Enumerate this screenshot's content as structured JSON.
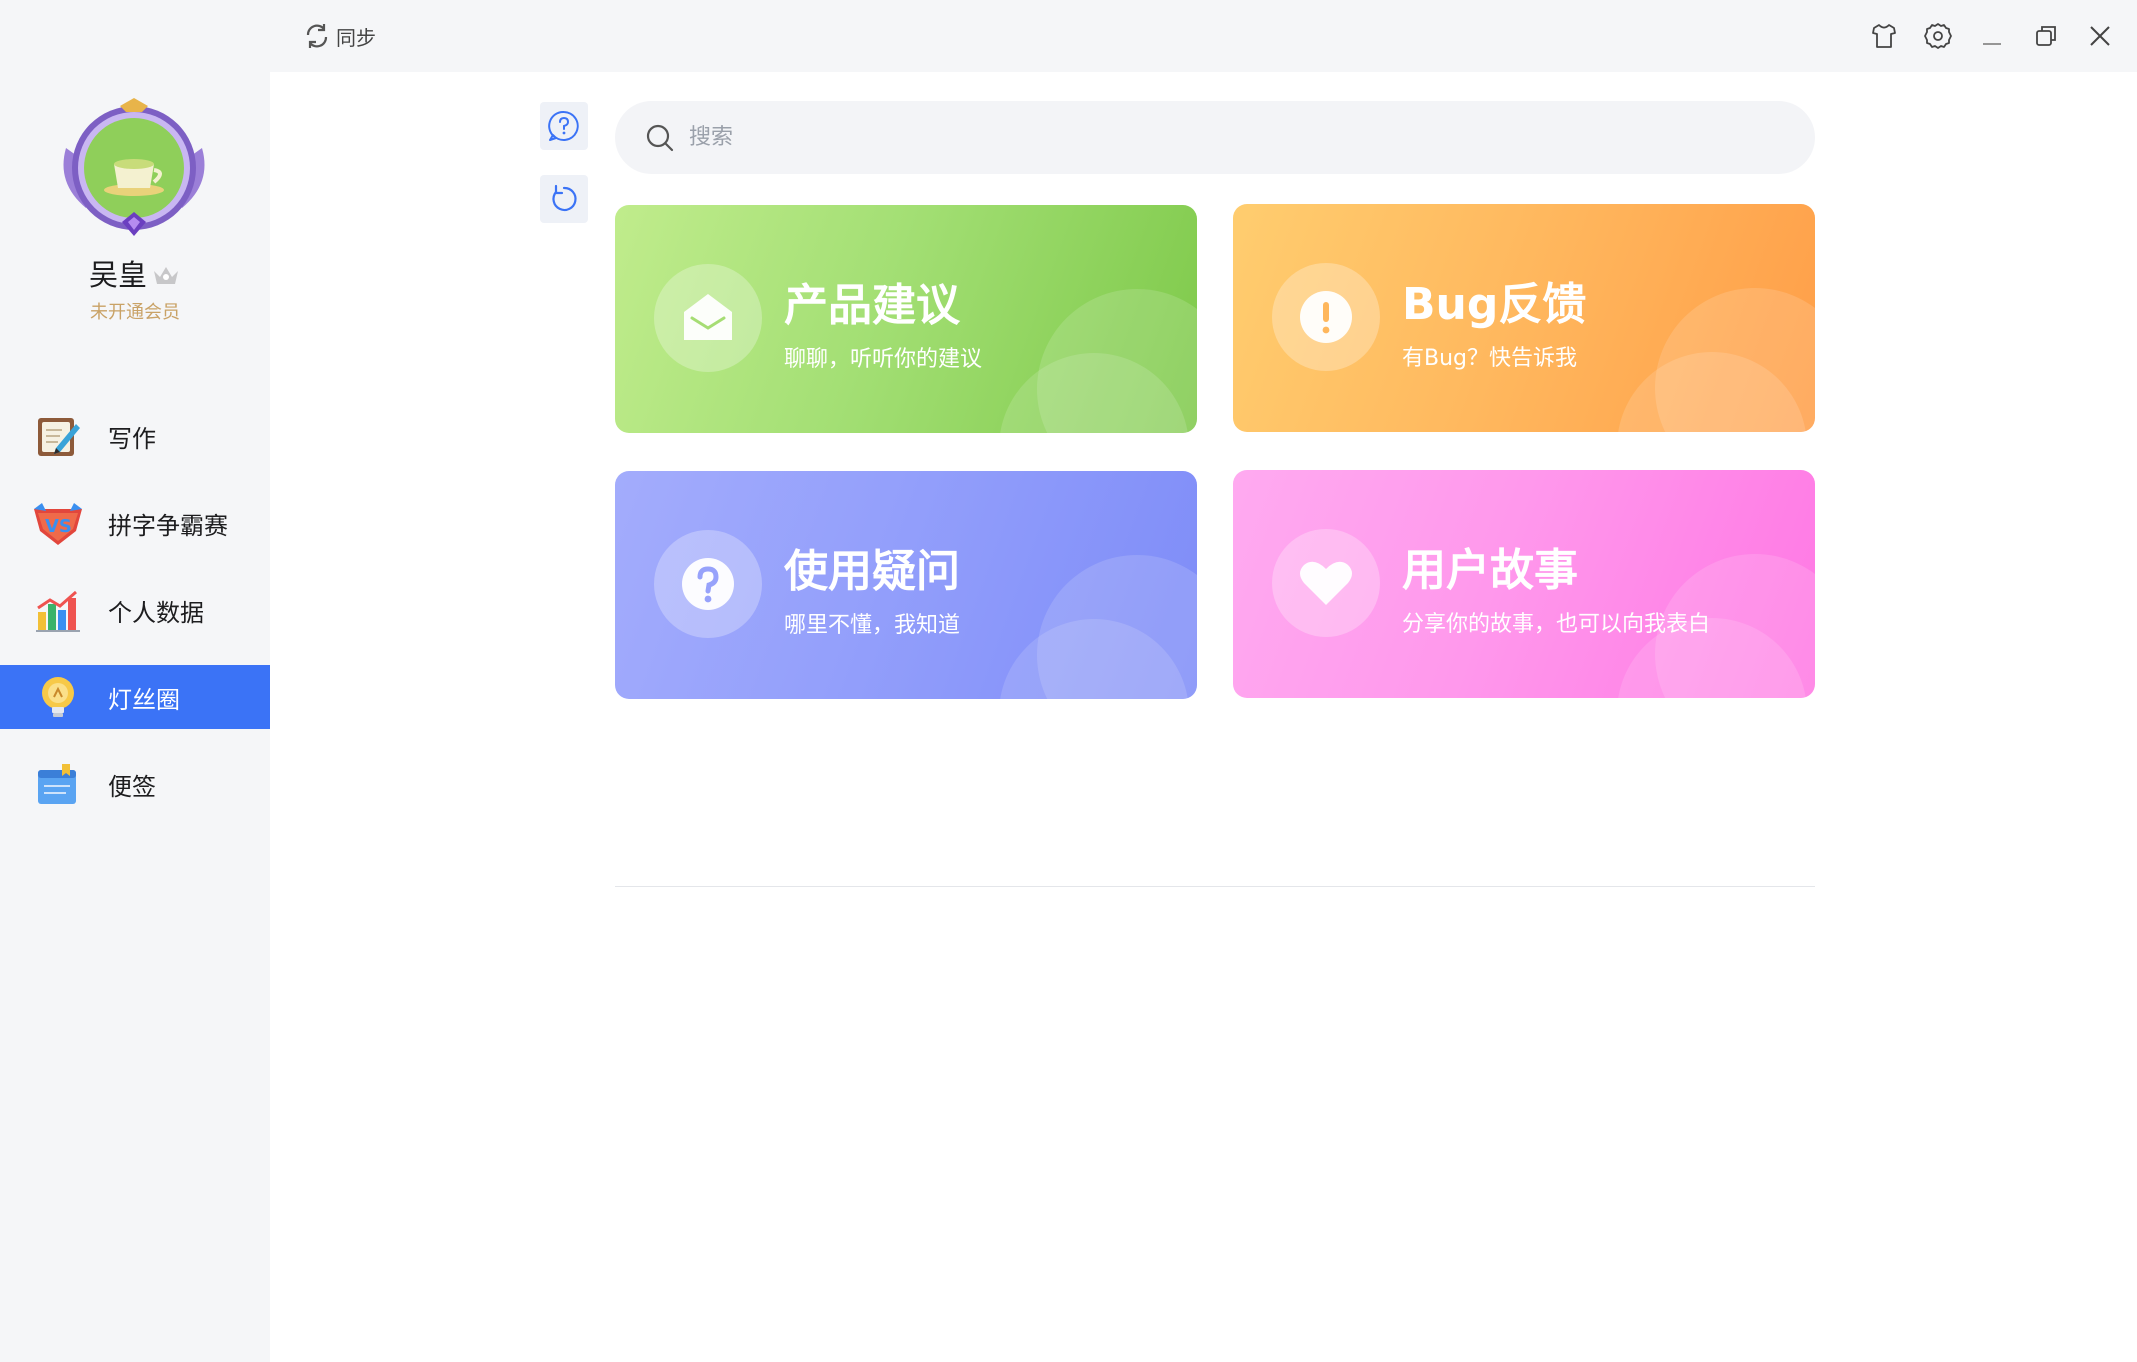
{
  "titlebar": {
    "sync_label": "同步",
    "icons": [
      "shirt-icon",
      "gear-icon",
      "minimize-icon",
      "restore-icon",
      "close-icon"
    ]
  },
  "profile": {
    "username": "吴皇",
    "member_status": "未开通会员"
  },
  "nav": {
    "items": [
      {
        "label": "写作",
        "icon": "writing-icon"
      },
      {
        "label": "拼字争霸赛",
        "icon": "vs-icon"
      },
      {
        "label": "个人数据",
        "icon": "bar-chart-icon"
      },
      {
        "label": "灯丝圈",
        "icon": "bulb-icon",
        "active": true
      },
      {
        "label": "便签",
        "icon": "notepad-icon"
      }
    ]
  },
  "search": {
    "placeholder": "搜索"
  },
  "cards": [
    {
      "title": "产品建议",
      "subtitle": "聊聊，听听你的建议",
      "icon": "envelope-icon",
      "color": "#8fd45c"
    },
    {
      "title": "Bug反馈",
      "subtitle": "有Bug？快告诉我",
      "icon": "exclamation-icon",
      "color": "#ffad55"
    },
    {
      "title": "使用疑问",
      "subtitle": "哪里不懂，我知道",
      "icon": "question-icon",
      "color": "#8d99fa"
    },
    {
      "title": "用户故事",
      "subtitle": "分享你的故事，也可以向我表白",
      "icon": "heart-icon",
      "color": "#ff8ae8"
    }
  ],
  "colors": {
    "accent": "#3b73f6",
    "member_gold": "#c9a266"
  }
}
